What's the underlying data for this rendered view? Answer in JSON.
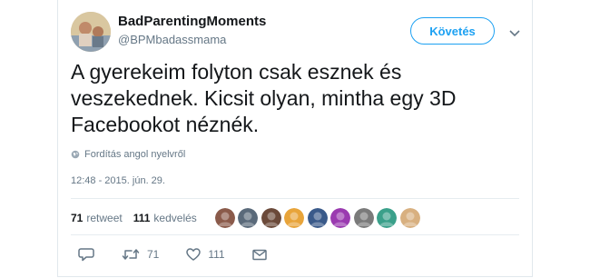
{
  "author": {
    "display_name": "BadParentingMoments",
    "handle": "@BPMbadassmama"
  },
  "follow_button": {
    "label": "Követés"
  },
  "tweet": {
    "text_line1": "A gyerekeim folyton csak esznek és",
    "text_line2": "veszekednek. Kicsit olyan, mintha egy 3D",
    "text_line3": "Facebookot néznék.",
    "translation_note": "Fordítás angol nyelvről",
    "timestamp": "12:48 - 2015. jún. 29."
  },
  "stats": {
    "retweets_count": "71",
    "retweets_label": "retweet",
    "likes_count": "111",
    "likes_label": "kedvelés"
  },
  "likers": [
    {
      "icon": "liker-avatar",
      "color": "#8a5a4a"
    },
    {
      "icon": "liker-avatar",
      "color": "#5a6a7a"
    },
    {
      "icon": "liker-avatar",
      "color": "#6b4a3a"
    },
    {
      "icon": "liker-avatar",
      "color": "#e8a43a"
    },
    {
      "icon": "liker-avatar",
      "color": "#3a5a8a"
    },
    {
      "icon": "liker-avatar",
      "color": "#9a3ab0"
    },
    {
      "icon": "liker-avatar",
      "color": "#7a7a7a"
    },
    {
      "icon": "liker-avatar",
      "color": "#3aa08a"
    },
    {
      "icon": "liker-avatar",
      "color": "#d8b080"
    }
  ],
  "actions": {
    "retweet_count": "71",
    "like_count": "111"
  },
  "colors": {
    "accent": "#1da1f2",
    "muted": "#657786"
  }
}
